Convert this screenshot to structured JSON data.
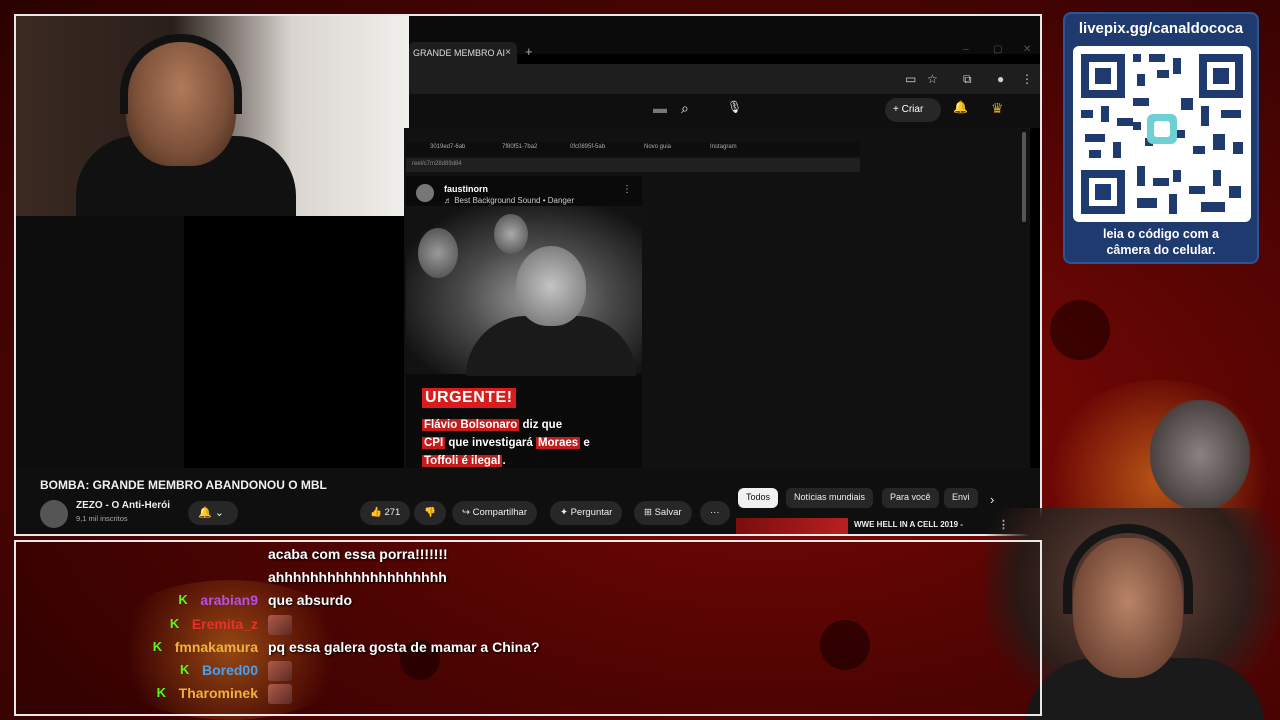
{
  "browser": {
    "tab_label": "GRANDE MEMBRO AI",
    "tab_close": "×",
    "new_tab": "+",
    "window_controls": [
      "–",
      "▢",
      "✕"
    ]
  },
  "youtube_header": {
    "create_label": "Criar",
    "search_icon": "⌕",
    "mic_icon": "🎙",
    "bell_icon": "🔔"
  },
  "embedded_browser": {
    "tabs": [
      "3019ed7-6ab",
      "7f80f51-7ba2",
      "0fc0895f-5ab",
      "Novo guia",
      "Instagram"
    ],
    "address": "reel/c7m28d89d84"
  },
  "reel": {
    "username": "faustinorn",
    "sound": "♬ Best Background Sound • Danger",
    "badge": "URGENTE!",
    "line1_a": "Flávio Bolsonaro",
    "line1_b": " diz que",
    "line2_a": "CPI",
    "line2_b": " que investigará ",
    "line2_c": "Moraes",
    "line2_d": " e",
    "line3_a": "Toffoli é ilegal",
    "line3_b": "."
  },
  "video_info": {
    "title": "BOMBA: GRANDE MEMBRO ABANDONOU O MBL",
    "channel": "ZEZO - O Anti-Herói",
    "subscribers": "9,1 mil inscritos",
    "bell": "🔔 ⌄",
    "likes": "👍 271",
    "dislike": "👎",
    "share": "↪ Compartilhar",
    "ask": "✦ Perguntar",
    "save": "⊞ Salvar",
    "more": "···"
  },
  "chips": [
    "Todos",
    "Notícias mundiais",
    "Para você",
    "Envi"
  ],
  "chip_next": "›",
  "related": {
    "title": "WWE HELL IN A CELL 2019 -",
    "menu": "⋮"
  },
  "qr_panel": {
    "url": "livepix.gg/canaldococa",
    "caption_line1": "leia o código com a",
    "caption_line2": "câmera do celular."
  },
  "chat": [
    {
      "user": "",
      "color": "#ffffff",
      "message": "acaba com essa porra!!!!!!!",
      "badge": false,
      "emote": false
    },
    {
      "user": "",
      "color": "#ffffff",
      "message": "ahhhhhhhhhhhhhhhhhhhh",
      "badge": false,
      "emote": false
    },
    {
      "user": "arabian9",
      "color": "#b84ee8",
      "message": "que absurdo",
      "badge": true,
      "emote": false
    },
    {
      "user": "Eremita_z",
      "color": "#e8302a",
      "message": "",
      "badge": true,
      "emote": true
    },
    {
      "user": "fmnakamura",
      "color": "#f0b040",
      "message": "pq essa galera gosta de mamar a China?",
      "badge": true,
      "emote": false
    },
    {
      "user": "Bored00",
      "color": "#4aa0f0",
      "message": "",
      "badge": true,
      "emote": true
    },
    {
      "user": "Tharominek",
      "color": "#f0b040",
      "message": "",
      "badge": true,
      "emote": true
    }
  ],
  "chat_badge_symbol": "K",
  "colors": {
    "accent_red": "#d91c1c",
    "qr_panel_bg": "#1f3a6e",
    "kick_green": "#53fc18"
  }
}
